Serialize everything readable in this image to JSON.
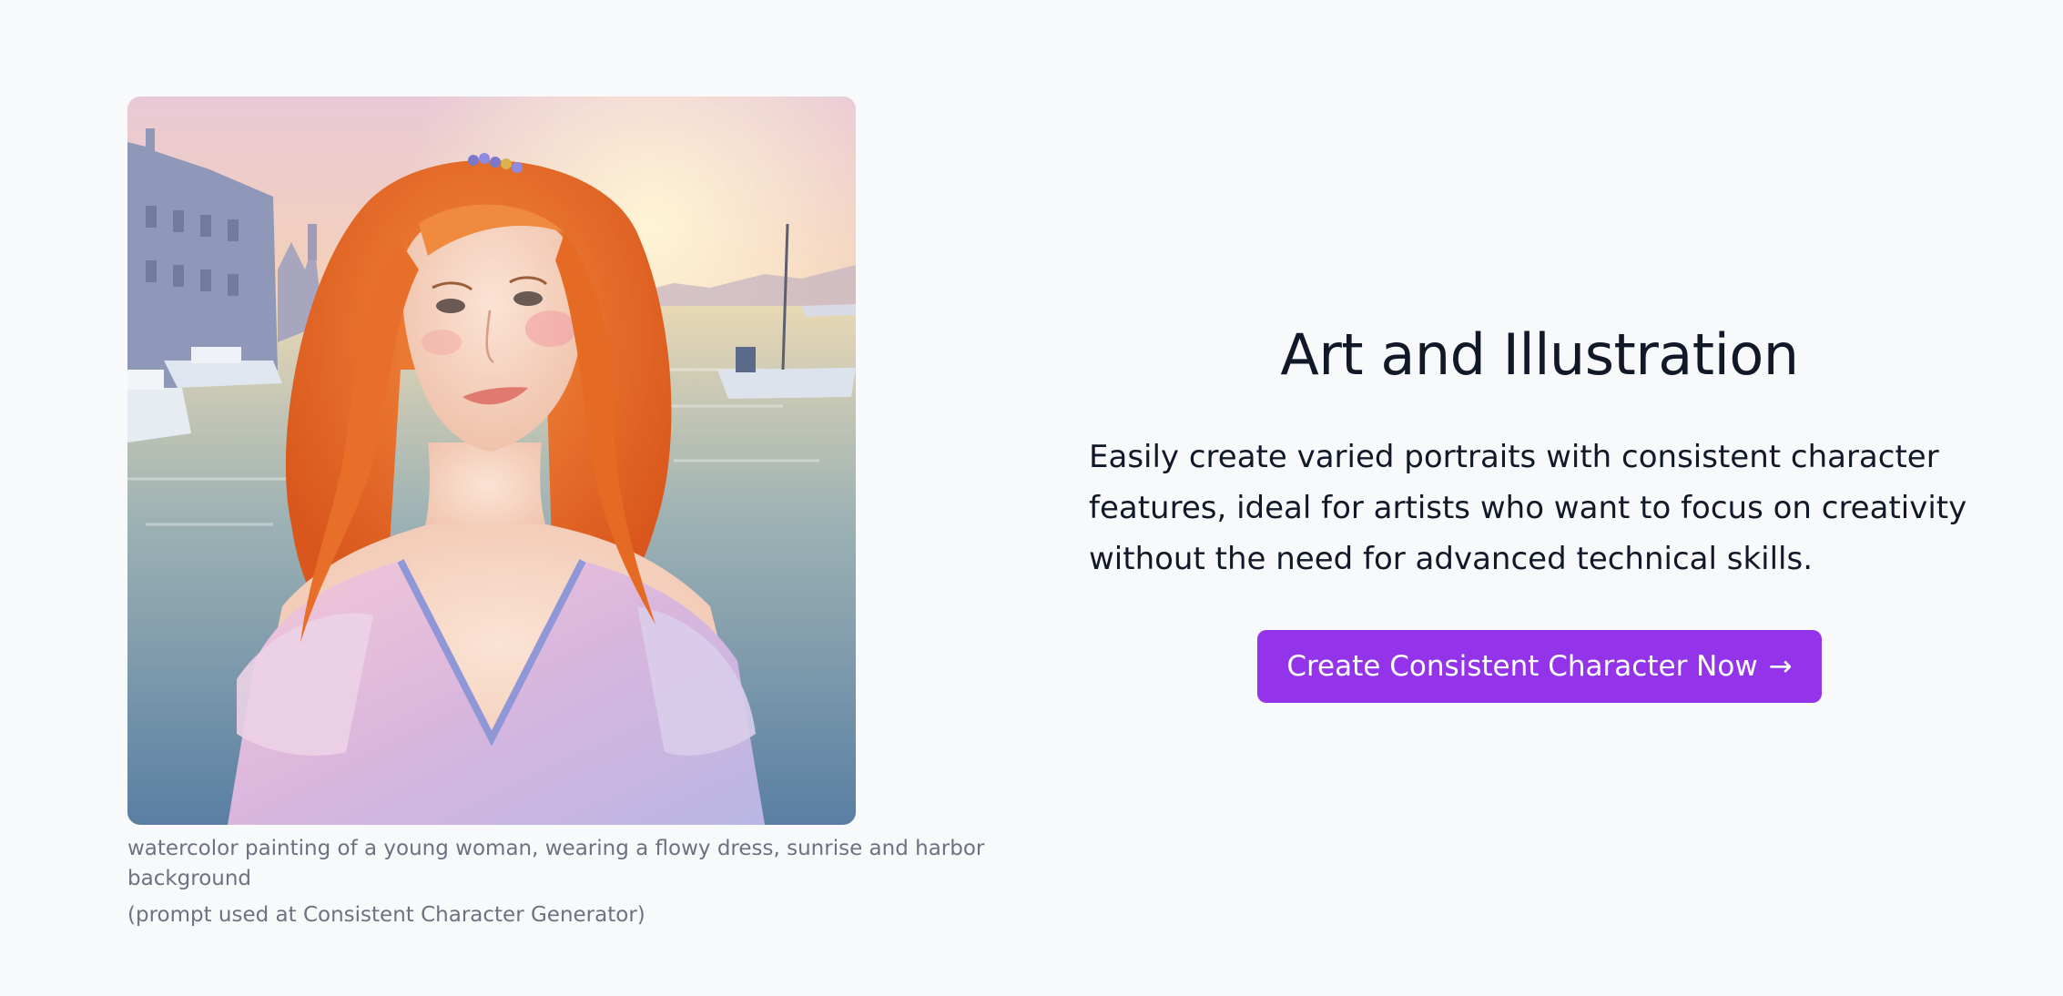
{
  "feature": {
    "heading": "Art and Illustration",
    "description": "Easily create varied portraits with consistent character features, ideal for artists who want to focus on creativity without the need for advanced technical skills.",
    "cta_label": "Create Consistent Character Now",
    "cta_icon": "arrow-right-icon",
    "cta_color": "#9333ea"
  },
  "image": {
    "alt": "watercolor painting of a young woman, wearing a flowy dress, sunrise and harbor background",
    "caption_prompt": "watercolor painting of a young woman, wearing a flowy dress, sunrise and harbor background",
    "caption_source": "(prompt used at Consistent Character Generator)"
  },
  "colors": {
    "background": "#f8f9fb",
    "heading": "#111827",
    "caption": "#6b7280",
    "accent": "#9333ea"
  }
}
